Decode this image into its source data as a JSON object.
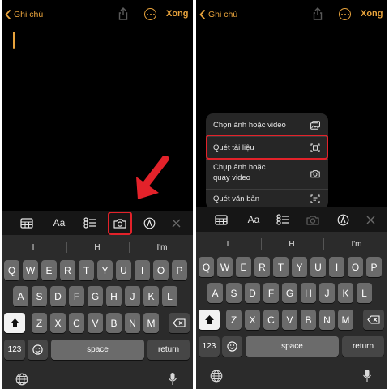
{
  "nav": {
    "back_label": "Ghi chú",
    "done_label": "Xong"
  },
  "toolbar": {
    "text_style_label": "Aa",
    "items": [
      "table-icon",
      "text-format-icon",
      "checklist-icon",
      "camera-icon",
      "markup-pen-icon",
      "close-icon"
    ]
  },
  "keyboard": {
    "suggestions": [
      "I",
      "H",
      "I'm"
    ],
    "row1": [
      "Q",
      "W",
      "E",
      "R",
      "T",
      "Y",
      "U",
      "I",
      "O",
      "P"
    ],
    "row2": [
      "A",
      "S",
      "D",
      "F",
      "G",
      "H",
      "J",
      "K",
      "L"
    ],
    "row3": [
      "Z",
      "X",
      "C",
      "V",
      "B",
      "N",
      "M"
    ],
    "numbers_label": "123",
    "space_label": "space",
    "return_label": "return"
  },
  "camera_menu": {
    "items": [
      {
        "label": "Chọn ảnh hoặc video",
        "icon": "photo-library-icon"
      },
      {
        "label": "Quét tài liệu",
        "icon": "document-scan-icon"
      },
      {
        "label_line1": "Chụp ảnh hoặc",
        "label_line2": "quay video",
        "icon": "camera-icon"
      },
      {
        "label": "Quét văn bản",
        "icon": "text-scan-icon"
      }
    ]
  },
  "colors": {
    "accent": "#e8a33c",
    "highlight": "#e3222a",
    "background": "#000000",
    "key": "#6b6b6b"
  }
}
